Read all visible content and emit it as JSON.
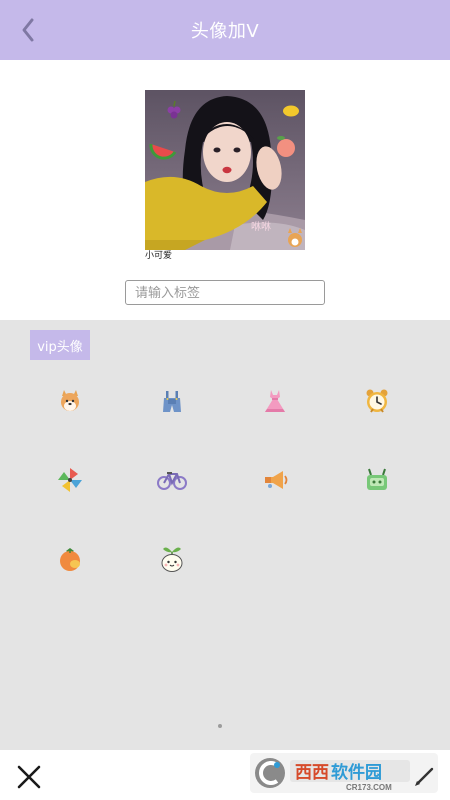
{
  "header": {
    "title": "头像加V",
    "back_icon": "chevron-left-icon"
  },
  "preview": {
    "caption": "小可爱",
    "photo_text": "咻咻"
  },
  "tag_input": {
    "value": "",
    "placeholder": "请输入标签"
  },
  "tabs": [
    {
      "label": "vip头像",
      "selected": true
    }
  ],
  "stickers": [
    {
      "icon": "corgi-dog-icon"
    },
    {
      "icon": "overalls-icon"
    },
    {
      "icon": "pink-dress-icon"
    },
    {
      "icon": "alarm-clock-icon"
    },
    {
      "icon": "pinwheel-icon"
    },
    {
      "icon": "bicycle-icon"
    },
    {
      "icon": "megaphone-icon"
    },
    {
      "icon": "green-cup-icon"
    },
    {
      "icon": "persimmon-icon"
    },
    {
      "icon": "sprout-bun-icon"
    }
  ],
  "pager": {
    "current": 1,
    "total": 1
  },
  "footer": {
    "close_icon": "close-icon"
  },
  "watermark": {
    "brand": "西西软件园",
    "url": "CR173.COM"
  },
  "colors": {
    "accent": "#c5b9ea",
    "panel": "#e4e4e4"
  }
}
